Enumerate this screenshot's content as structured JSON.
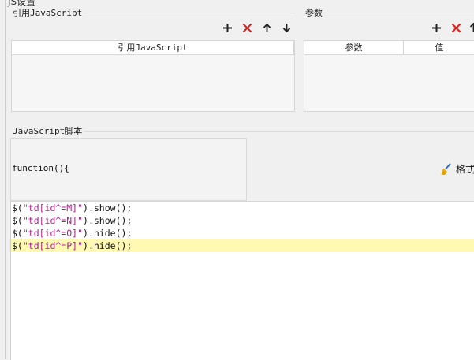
{
  "window": {
    "title_fragment": "JS设置"
  },
  "ref_js": {
    "group_title": "引用JavaScript",
    "column_header": "引用JavaScript",
    "toolbar": {
      "add_icon": "plus-icon",
      "delete_icon": "close-icon",
      "up_icon": "arrow-up-icon",
      "down_icon": "arrow-down-icon"
    }
  },
  "params": {
    "group_title": "参数",
    "columns": [
      "参数",
      "值"
    ],
    "toolbar": {
      "add_icon": "plus-icon",
      "delete_icon": "close-icon"
    }
  },
  "script": {
    "group_title": "JavaScript脚本",
    "function_header": "function(){",
    "format_button": "格式",
    "format_icon": "broom-icon",
    "code_lines": [
      {
        "prefix": "$(",
        "string": "\"td[id^=M]\"",
        "suffix": ").show();"
      },
      {
        "prefix": "$(",
        "string": "\"td[id^=N]\"",
        "suffix": ").show();"
      },
      {
        "prefix": "$(",
        "string": "\"td[id^=O]\"",
        "suffix": ").hide();"
      },
      {
        "prefix": "$(",
        "string": "\"td[id^=P]\"",
        "suffix": ").hide();"
      }
    ],
    "highlighted_line": 3
  },
  "colors": {
    "delete": "#e02020",
    "highlight": "#fff9b3",
    "string": "#b02090"
  }
}
